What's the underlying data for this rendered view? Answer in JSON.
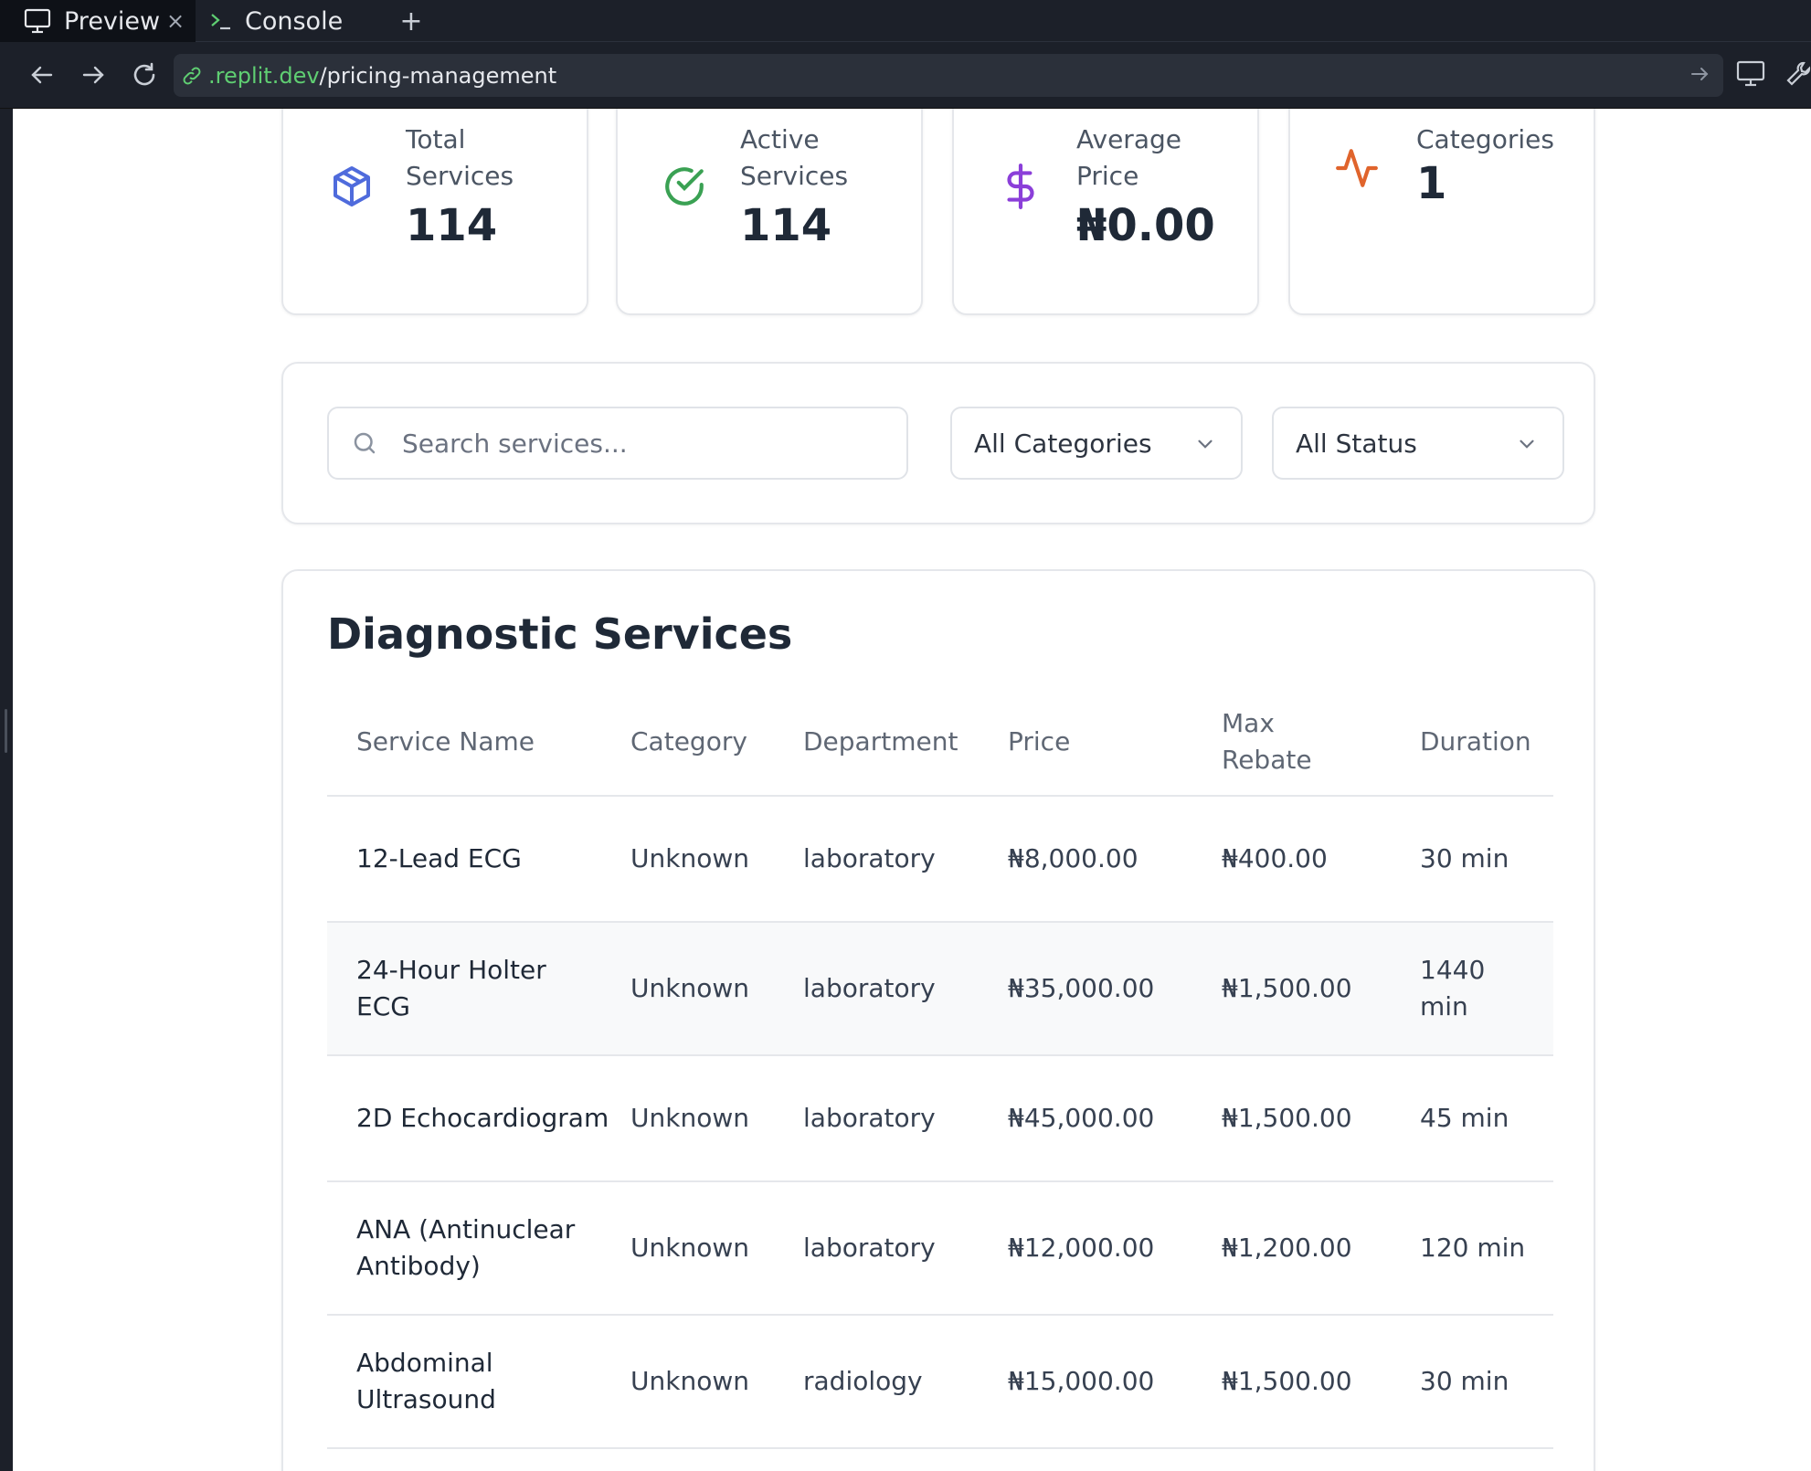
{
  "browser": {
    "tabs": [
      {
        "label": "Preview",
        "close": "×"
      },
      {
        "label": "Console"
      }
    ],
    "new_tab": "+",
    "url": {
      "domain": ".replit.dev",
      "path": "/pricing-management"
    }
  },
  "stats": [
    {
      "label_line1": "Total",
      "label_line2": "Services",
      "value": "114",
      "icon": "box-icon",
      "color": "#4f6bdc"
    },
    {
      "label_line1": "Active",
      "label_line2": "Services",
      "value": "114",
      "icon": "check-circle-icon",
      "color": "#3aa153"
    },
    {
      "label_line1": "Average",
      "label_line2": "Price",
      "value": "₦0.00",
      "icon": "dollar-icon",
      "color": "#8b3fd9"
    },
    {
      "label_line1": "Categories",
      "label_line2": "",
      "value": "1",
      "icon": "activity-icon",
      "color": "#e0642c"
    }
  ],
  "filters": {
    "search_placeholder": "Search services...",
    "category_selected": "All Categories",
    "status_selected": "All Status"
  },
  "table": {
    "title": "Diagnostic Services",
    "columns": [
      "Service Name",
      "Category",
      "Department",
      "Price",
      "Max Rebate",
      "Duration"
    ],
    "rows": [
      [
        "12-Lead ECG",
        "Unknown",
        "laboratory",
        "₦8,000.00",
        "₦400.00",
        "30 min"
      ],
      [
        "24-Hour Holter ECG",
        "Unknown",
        "laboratory",
        "₦35,000.00",
        "₦1,500.00",
        "1440 min"
      ],
      [
        "2D Echocardiogram",
        "Unknown",
        "laboratory",
        "₦45,000.00",
        "₦1,500.00",
        "45 min"
      ],
      [
        "ANA (Antinuclear Antibody)",
        "Unknown",
        "laboratory",
        "₦12,000.00",
        "₦1,200.00",
        "120 min"
      ],
      [
        "Abdominal Ultrasound",
        "Unknown",
        "radiology",
        "₦15,000.00",
        "₦1,500.00",
        "30 min"
      ]
    ]
  }
}
